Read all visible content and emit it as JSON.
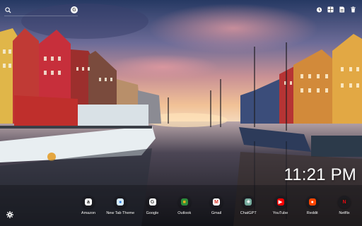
{
  "background": {
    "scene": "canal-harbour-sunset",
    "colors": {
      "sky_top": "#2b3b66",
      "sky_mid": "#8a6f96",
      "glow": "#f3b27c",
      "water": "#1b1c23"
    }
  },
  "search": {
    "icon": "search-icon",
    "engine_icon": "google-g-icon",
    "engine_letter": "G"
  },
  "top_icons": [
    {
      "name": "timer-icon",
      "glyph": "◷"
    },
    {
      "name": "grid-icon",
      "glyph": "▦"
    },
    {
      "name": "note-icon",
      "glyph": "▤"
    },
    {
      "name": "trash-icon",
      "glyph": "▮"
    }
  ],
  "clock": {
    "time": "11:21 PM"
  },
  "apps": [
    {
      "label": "Amazon",
      "icon": "amazon-icon",
      "glyph": "a",
      "fg": "#111111",
      "bg": "#ffffff"
    },
    {
      "label": "New Tab Theme",
      "icon": "new-tab-theme-icon",
      "glyph": "●",
      "fg": "#2b7fe0",
      "bg": "#d7ecff"
    },
    {
      "label": "Google",
      "icon": "google-icon",
      "glyph": "G",
      "fg": "#444444",
      "bg": "#ffffff"
    },
    {
      "label": "Outlook",
      "icon": "outlook-icon",
      "glyph": "■",
      "fg": "#f2b21b",
      "bg": "#2f8d3a"
    },
    {
      "label": "Gmail",
      "icon": "gmail-icon",
      "glyph": "M",
      "fg": "#d93025",
      "bg": "#ffffff"
    },
    {
      "label": "ChatGPT",
      "icon": "chatgpt-icon",
      "glyph": "✳",
      "fg": "#ffffff",
      "bg": "#74aa9c"
    },
    {
      "label": "YouTube",
      "icon": "youtube-icon",
      "glyph": "▶",
      "fg": "#ffffff",
      "bg": "#ff0000"
    },
    {
      "label": "Reddit",
      "icon": "reddit-icon",
      "glyph": "●",
      "fg": "#ffffff",
      "bg": "#ff4500"
    },
    {
      "label": "Netflix",
      "icon": "netflix-icon",
      "glyph": "N",
      "fg": "#e50914",
      "bg": "#1a1a1a"
    }
  ],
  "settings": {
    "icon": "settings-gear-icon"
  }
}
